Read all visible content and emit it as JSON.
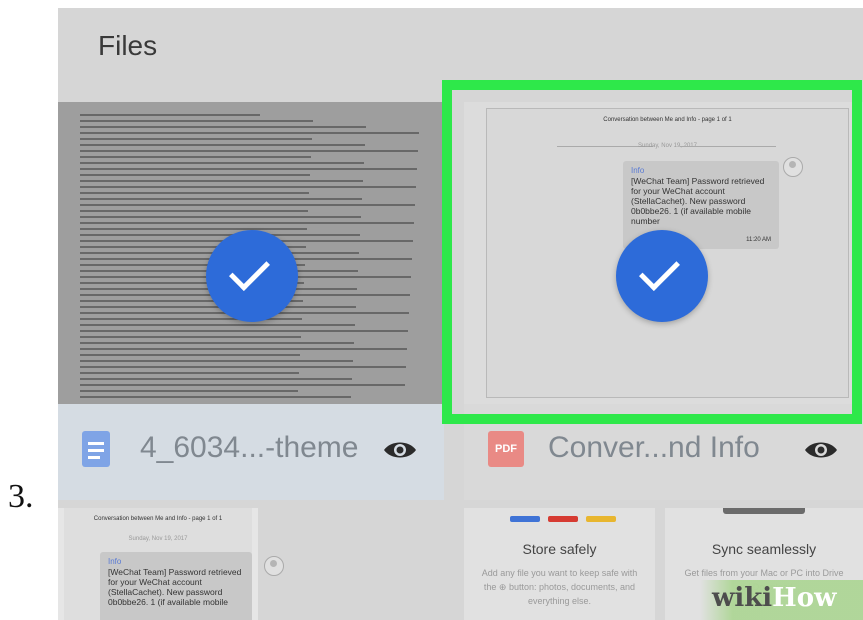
{
  "step_number": "3.",
  "app": {
    "title": "Files",
    "files": [
      {
        "name": "4_6034...-theme",
        "type": "doc",
        "selected": true
      },
      {
        "name": "Conver...nd Info",
        "type": "pdf",
        "type_label": "PDF",
        "selected": true,
        "highlighted": true
      }
    ],
    "preview": {
      "heading": "Conversation between Me and Info - page 1 of 1",
      "date": "Sunday, Nov 19, 2017",
      "sender": "Info",
      "message": "[WeChat Team] Password retrieved for your WeChat account (StellaCachet). New password 0b0bbe26. 1 (if available mobile number",
      "time": "11:20 AM"
    },
    "bottom_cards": {
      "mini_preview": {
        "heading": "Conversation between Me and Info - page 1 of 1",
        "date": "Sunday, Nov 19, 2017",
        "sender": "Info",
        "message": "[WeChat Team] Password retrieved for your WeChat account (StellaCachet). New password 0b0bbe26. 1 (if available mobile"
      },
      "store": {
        "title": "Store safely",
        "body": "Add any file you want to keep safe with the ⊕ button: photos, documents, and everything else."
      },
      "sync": {
        "title": "Sync seamlessly",
        "body": "Get files from your Mac or PC into Drive and Download"
      }
    }
  },
  "watermark": {
    "part1": "wiki",
    "part2": "How"
  },
  "colors": {
    "selection_border": "#2ee84a",
    "check_circle": "#2d6bd9"
  }
}
